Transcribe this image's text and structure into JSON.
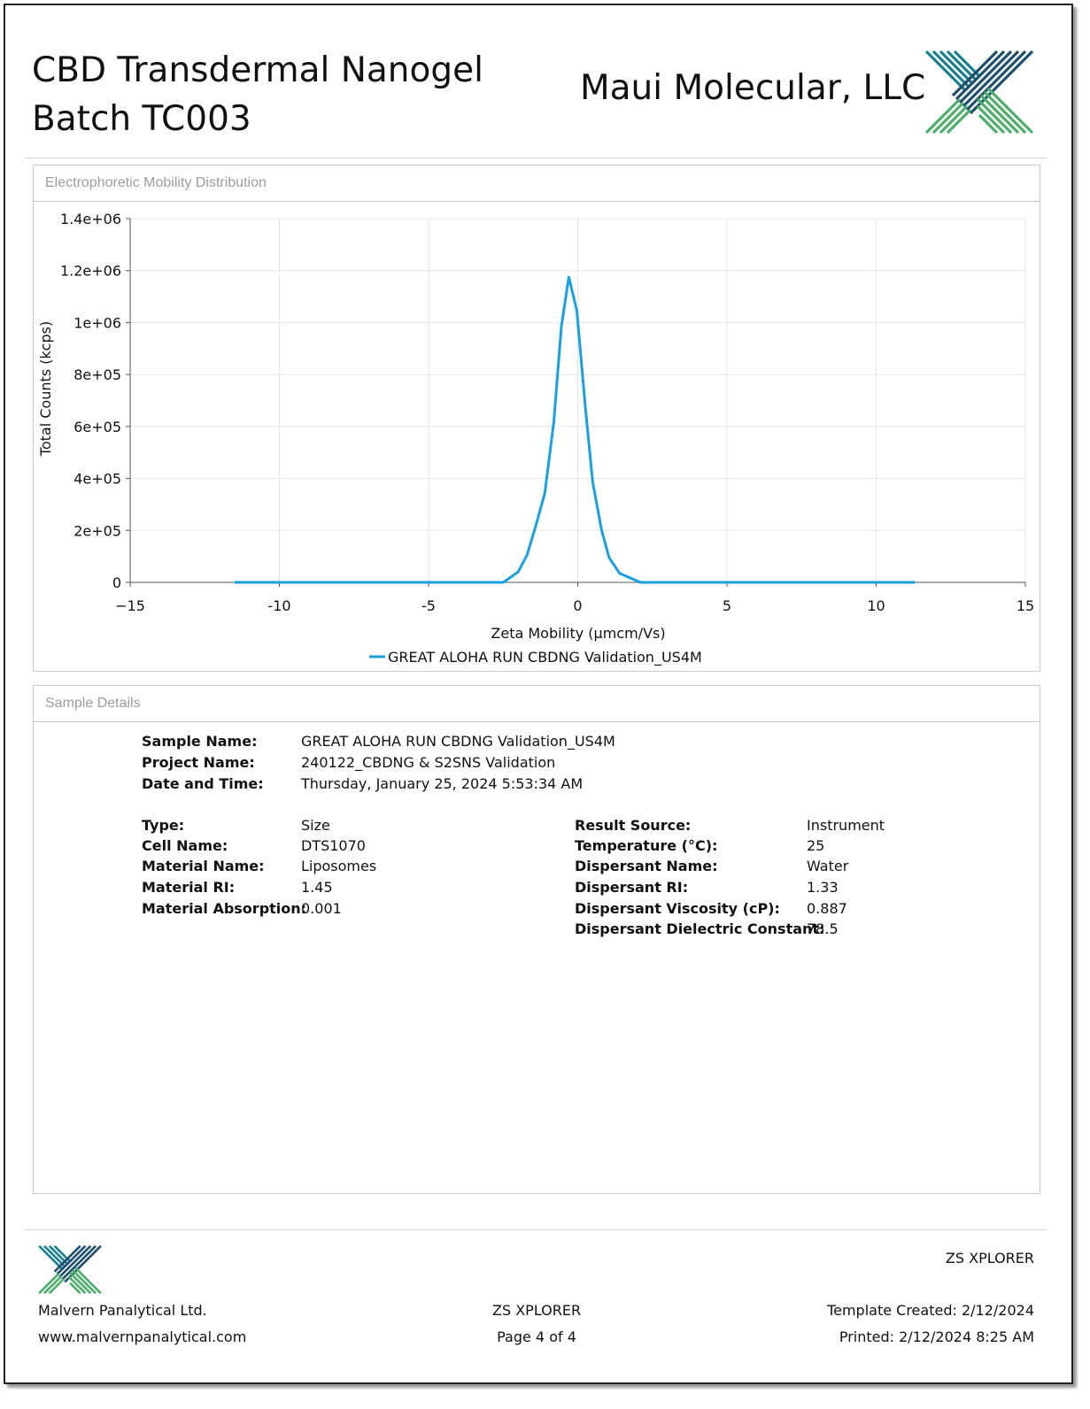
{
  "header": {
    "title": "CBD Transdermal Nanogel Batch TC003",
    "company": "Maui Molecular, LLC"
  },
  "chart_panel": {
    "heading": "Electrophoretic Mobility Distribution"
  },
  "chart_data": {
    "type": "line",
    "title": "",
    "xlabel": "Zeta Mobility (µmcm/Vs)",
    "ylabel": "Total Counts (kcps)",
    "xlim": [
      -15,
      15
    ],
    "ylim": [
      0,
      1400000
    ],
    "xticks": [
      "-15",
      "-10",
      "-5",
      "0",
      "5",
      "10",
      "15"
    ],
    "yticks": [
      "0",
      "2e+05",
      "4e+05",
      "6e+05",
      "8e+05",
      "1e+06",
      "1.2e+06",
      "1.4e+06"
    ],
    "grid": true,
    "legend_position": "bottom-center",
    "series": [
      {
        "name": "GREAT ALOHA RUN CBDNG Validation_US4M",
        "color": "#1a9fe0",
        "x": [
          -11.5,
          -2.5,
          -2.0,
          -1.7,
          -1.4,
          -1.1,
          -0.8,
          -0.55,
          -0.3,
          -0.03,
          0.25,
          0.5,
          0.8,
          1.05,
          1.4,
          2.1,
          11.3
        ],
        "y": [
          0,
          0,
          40000,
          105000,
          220000,
          345000,
          620000,
          985000,
          1175000,
          1045000,
          680000,
          385000,
          200000,
          95000,
          35000,
          0,
          0
        ]
      }
    ]
  },
  "details_panel": {
    "heading": "Sample Details",
    "sample_name_label": "Sample Name:",
    "sample_name": "GREAT ALOHA RUN CBDNG Validation_US4M",
    "project_name_label": "Project Name:",
    "project_name": "240122_CBDNG & S2SNS Validation",
    "date_time_label": "Date and Time:",
    "date_time": "Thursday, January 25, 2024 5:53:34 AM",
    "left": [
      {
        "label": "Type:",
        "value": "Size"
      },
      {
        "label": "Cell Name:",
        "value": "DTS1070"
      },
      {
        "label": "Material Name:",
        "value": "Liposomes"
      },
      {
        "label": "Material RI:",
        "value": "1.45"
      },
      {
        "label": "Material Absorption:",
        "value": "0.001"
      }
    ],
    "right": [
      {
        "label": "Result Source:",
        "value": "Instrument"
      },
      {
        "label": "Temperature (°C):",
        "value": "25"
      },
      {
        "label": "Dispersant Name:",
        "value": "Water"
      },
      {
        "label": "Dispersant RI:",
        "value": "1.33"
      },
      {
        "label": "Dispersant Viscosity (cP):",
        "value": "0.887"
      },
      {
        "label": "Dispersant Dielectric Constant:",
        "value": "78.5"
      }
    ]
  },
  "footer": {
    "product_top": "ZS XPLORER",
    "company": "Malvern Panalytical Ltd.",
    "website": "www.malvernpanalytical.com",
    "product": "ZS XPLORER",
    "page": "Page 4 of 4",
    "template_created": "Template Created:  2/12/2024",
    "printed": "Printed: 2/12/2024 8:25 AM"
  },
  "colors": {
    "logo_teal": "#1a7f93",
    "logo_navy": "#1e4f6f",
    "logo_green": "#4cae6a",
    "series_line": "#1a9fe0"
  }
}
